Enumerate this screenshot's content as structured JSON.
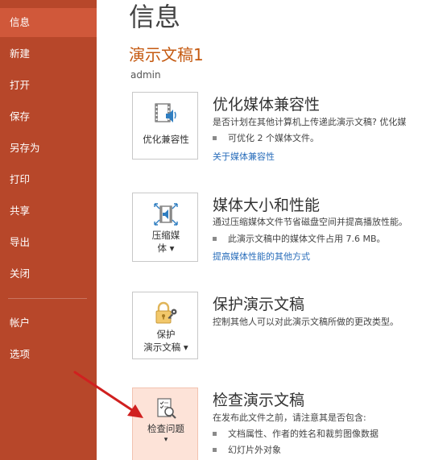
{
  "sidebar": {
    "items": [
      {
        "label": "信息"
      },
      {
        "label": "新建"
      },
      {
        "label": "打开"
      },
      {
        "label": "保存"
      },
      {
        "label": "另存为"
      },
      {
        "label": "打印"
      },
      {
        "label": "共享"
      },
      {
        "label": "导出"
      },
      {
        "label": "关闭"
      },
      {
        "label": "帐户"
      },
      {
        "label": "选项"
      }
    ]
  },
  "main": {
    "page_title": "信息",
    "doc_title": "演示文稿1",
    "owner": "admin",
    "sections": [
      {
        "button_label": "优化兼容性",
        "heading": "优化媒体兼容性",
        "description": "是否计划在其他计算机上传递此演示文稿? 优化媒",
        "bullet": "可优化 2 个媒体文件。",
        "link": "关于媒体兼容性"
      },
      {
        "button_label_1": "压缩媒",
        "button_label_2": "体 ▾",
        "heading": "媒体大小和性能",
        "description": "通过压缩媒体文件节省磁盘空间并提高播放性能。",
        "bullet": "此演示文稿中的媒体文件占用 7.6 MB。",
        "link": "提高媒体性能的其他方式"
      },
      {
        "button_label_1": "保护",
        "button_label_2": "演示文稿 ▾",
        "heading": "保护演示文稿",
        "description": "控制其他人可以对此演示文稿所做的更改类型。"
      },
      {
        "button_label_1": "检查问题",
        "button_label_2": "▾",
        "heading": "检查演示文稿",
        "description": "在发布此文件之前，请注意其是否包含:",
        "bullets": [
          "文档属性、作者的姓名和裁剪图像数据",
          "幻灯片外对象"
        ]
      }
    ]
  },
  "colors": {
    "sidebar_bg": "#b7472a",
    "sidebar_active": "#d0583a",
    "doc_title": "#c55a11",
    "link": "#2a6ebb",
    "highlight_card": "#fde3d8",
    "arrow": "#d0201f"
  },
  "icons": [
    "media-compat-icon",
    "compress-media-icon",
    "lock-key-icon",
    "inspect-document-icon"
  ]
}
